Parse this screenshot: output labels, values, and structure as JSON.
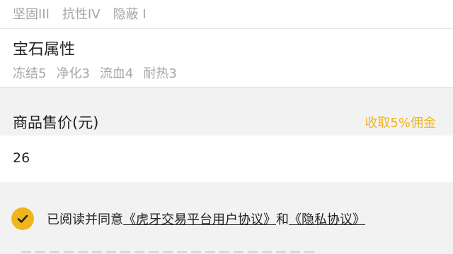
{
  "skills": [
    "坚固III",
    "抗性IV",
    "隐蔽 I"
  ],
  "gem": {
    "title": "宝石属性",
    "attributes": [
      "冻结5",
      "净化3",
      "流血4",
      "耐热3"
    ]
  },
  "price": {
    "label": "商品售价(元)",
    "commission": "收取5%佣金",
    "value": "26"
  },
  "agreement": {
    "prefix": "已阅读并同意",
    "link1": "《虎牙交易平台用户协议》",
    "middle": "和",
    "link2": "《隐私协议》"
  },
  "colors": {
    "accent": "#f0b51b",
    "muted_text": "#a6a6a6",
    "background": "#f2f2f2"
  },
  "icons": {
    "checkbox": "check-icon"
  }
}
